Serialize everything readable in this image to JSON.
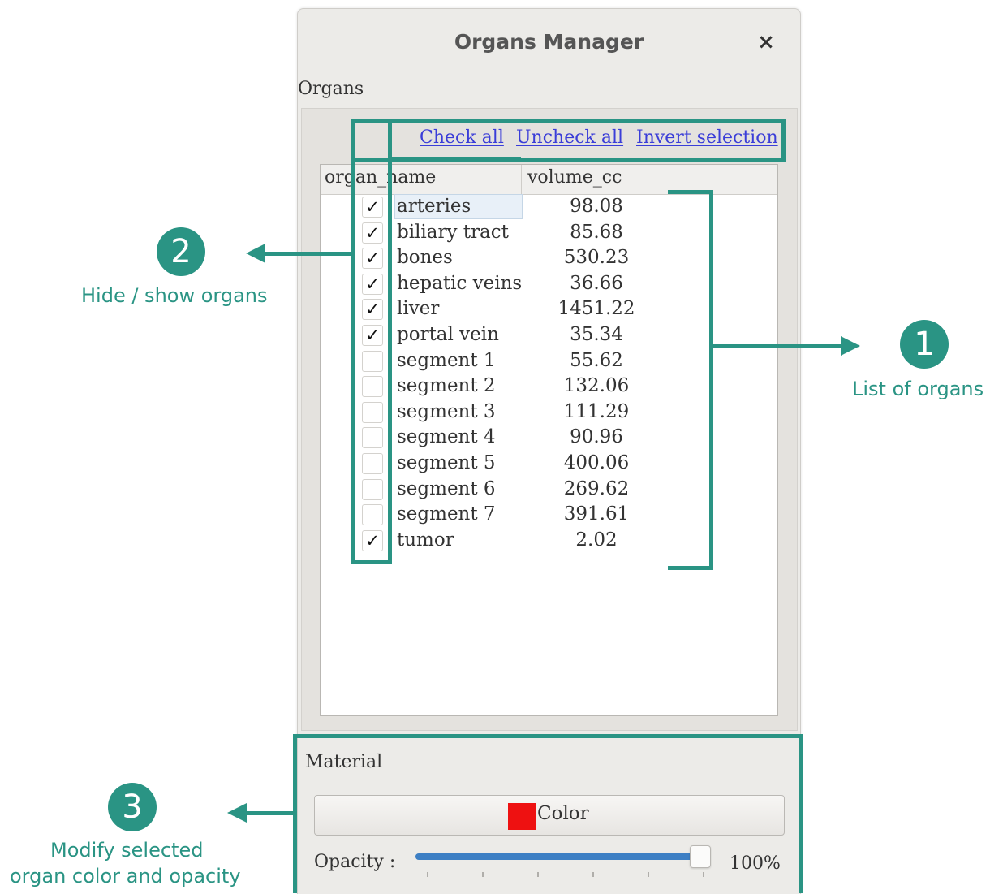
{
  "dialog": {
    "title": "Organs Manager",
    "close_glyph": "×",
    "close_icon": "close-icon"
  },
  "organs": {
    "label": "Organs",
    "links": {
      "check_all": "Check all",
      "uncheck_all": "Uncheck all",
      "invert_selection": "Invert selection"
    },
    "columns": {
      "name": "organ_name",
      "volume": "volume_cc"
    },
    "check_glyph": "✓",
    "selected_row": "arteries",
    "rows": [
      {
        "name": "arteries",
        "volume": "98.08",
        "checked": true
      },
      {
        "name": "biliary tract",
        "volume": "85.68",
        "checked": true
      },
      {
        "name": "bones",
        "volume": "530.23",
        "checked": true
      },
      {
        "name": "hepatic veins",
        "volume": "36.66",
        "checked": true
      },
      {
        "name": "liver",
        "volume": "1451.22",
        "checked": true
      },
      {
        "name": "portal vein",
        "volume": "35.34",
        "checked": true
      },
      {
        "name": "segment 1",
        "volume": "55.62",
        "checked": false
      },
      {
        "name": "segment 2",
        "volume": "132.06",
        "checked": false
      },
      {
        "name": "segment 3",
        "volume": "111.29",
        "checked": false
      },
      {
        "name": "segment 4",
        "volume": "90.96",
        "checked": false
      },
      {
        "name": "segment 5",
        "volume": "400.06",
        "checked": false
      },
      {
        "name": "segment 6",
        "volume": "269.62",
        "checked": false
      },
      {
        "name": "segment 7",
        "volume": "391.61",
        "checked": false
      },
      {
        "name": "tumor",
        "volume": "2.02",
        "checked": true
      }
    ]
  },
  "material": {
    "label": "Material",
    "color_button_label": "Color",
    "color_value": "#ee1111",
    "opacity_label": "Opacity :",
    "opacity_value": "100%",
    "opacity_fraction": 1.0
  },
  "annotations": {
    "accent_color": "#2a9484",
    "items": [
      {
        "number": "1",
        "text": "List of organs"
      },
      {
        "number": "2",
        "text": "Hide / show organs"
      },
      {
        "number": "3",
        "line1": "Modify selected",
        "line2": "organ color and opacity"
      }
    ]
  }
}
